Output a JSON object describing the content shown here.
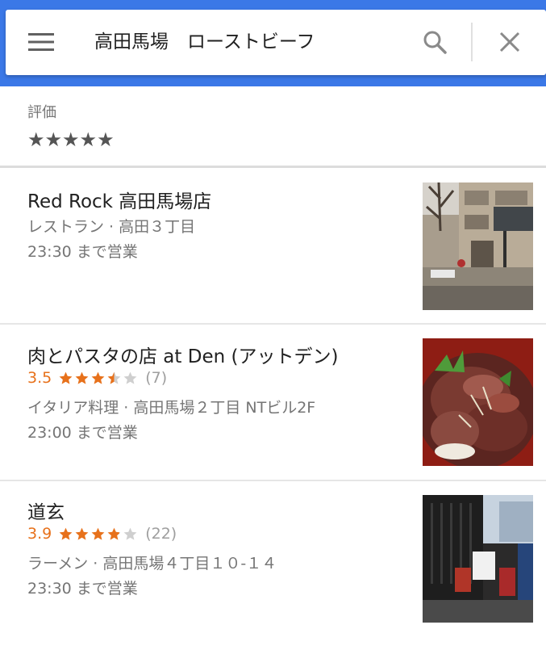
{
  "search": {
    "query": "高田馬場　ローストビーフ",
    "menu_icon": "menu-icon",
    "search_icon": "search-icon",
    "close_icon": "close-icon"
  },
  "filter": {
    "label": "評価",
    "stars": "★★★★★"
  },
  "colors": {
    "header": "#3b78e7",
    "rating": "#e7711b",
    "star_empty": "#cfcfcf"
  },
  "results": [
    {
      "name": "Red Rock 高田馬場店",
      "meta": "レストラン · 高田３丁目",
      "hours": "23:30 まで営業",
      "thumbnail": "building-street-photo"
    },
    {
      "name": "肉とパスタの店 at Den (アットデン)",
      "rating": "3.5",
      "rating_value": 3.5,
      "review_count": "(7)",
      "meta": "イタリア料理 · 高田馬場２丁目 NTビル2F",
      "hours": "23:00 まで営業",
      "thumbnail": "roast-beef-bowl-photo"
    },
    {
      "name": "道玄",
      "rating": "3.9",
      "rating_value": 3.9,
      "review_count": "(22)",
      "meta": "ラーメン · 高田馬場４丁目１０-１４",
      "hours": "23:30 まで営業",
      "thumbnail": "restaurant-storefront-photo"
    }
  ]
}
